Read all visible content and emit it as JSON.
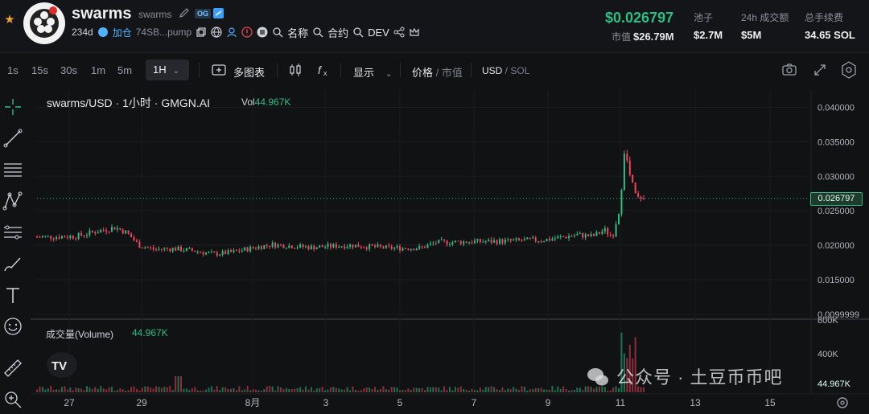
{
  "header": {
    "token_name": "swarms",
    "token_subname": "swarms",
    "og_badge": "OG",
    "age": "234d",
    "follow_label": "加仓",
    "address": "74SB...pump",
    "links": [
      "名称",
      "合约",
      "DEV"
    ],
    "price": "$0.026797",
    "mcap_label": "市值",
    "mcap_value": "$26.79M",
    "stats": [
      {
        "label": "池子",
        "value": "$2.7M"
      },
      {
        "label": "24h 成交额",
        "value": "$5M"
      },
      {
        "label": "总手续费",
        "value": "34.65 SOL"
      }
    ]
  },
  "toolbar": {
    "intervals": [
      "1s",
      "15s",
      "30s",
      "1m",
      "5m"
    ],
    "active_interval": "1H",
    "multi_chart": "多图表",
    "display": "显示",
    "price_mode": "价格",
    "price_mode_alt": "市值",
    "currency": "USD",
    "currency_alt": "SOL"
  },
  "chart": {
    "title": "swarms/USD · 1小时 · GMGN.AI",
    "vol_label": "Vol",
    "vol_value": "44.967K",
    "volume_title": "成交量(Volume)",
    "volume_value": "44.967K",
    "current_price_label": "0.026797",
    "watermark": "公众号 · 土豆币币吧",
    "vol_right_label": "44.967K"
  },
  "chart_data": {
    "type": "line",
    "title": "swarms/USD · 1小时 · GMGN.AI",
    "x_ticks": [
      "27",
      "29",
      "8月",
      "3",
      "5",
      "7",
      "9",
      "11",
      "13",
      "15"
    ],
    "y_ticks": [
      "0.040000",
      "0.035000",
      "0.030000",
      "0.025000",
      "0.020000",
      "0.015000",
      "0.0099999"
    ],
    "y_tick_values": [
      0.04,
      0.035,
      0.03,
      0.025,
      0.02,
      0.015,
      0.01
    ],
    "volume_y_ticks": [
      "800K",
      "400K"
    ],
    "current_price": 0.026797,
    "series": [
      {
        "values": [
          [
            0,
            0.0212
          ],
          [
            1,
            0.0213
          ],
          [
            1.6,
            0.0221
          ],
          [
            2,
            0.0226
          ],
          [
            2.3,
            0.0218
          ],
          [
            2.6,
            0.02
          ],
          [
            3,
            0.0194
          ],
          [
            3.5,
            0.0195
          ],
          [
            4,
            0.0192
          ],
          [
            4.5,
            0.0187
          ],
          [
            5,
            0.019
          ],
          [
            5.5,
            0.0196
          ],
          [
            6,
            0.0201
          ],
          [
            7,
            0.0197
          ],
          [
            8,
            0.02
          ],
          [
            9,
            0.0196
          ],
          [
            9.8,
            0.0196
          ],
          [
            10.2,
            0.0204
          ],
          [
            11,
            0.0205
          ],
          [
            12,
            0.0206
          ],
          [
            13,
            0.0208
          ],
          [
            13.8,
            0.0215
          ],
          [
            14.2,
            0.0213
          ],
          [
            14.5,
            0.0222
          ],
          [
            14.7,
            0.0212
          ],
          [
            14.9,
            0.0258
          ],
          [
            15.0,
            0.034
          ],
          [
            15.15,
            0.03
          ],
          [
            15.3,
            0.027
          ],
          [
            15.5,
            0.0262
          ]
        ]
      }
    ]
  },
  "colors": {
    "up": "#2ebd85",
    "down": "#f6465d",
    "accent": "#4fb2ff",
    "background": "#111214"
  }
}
